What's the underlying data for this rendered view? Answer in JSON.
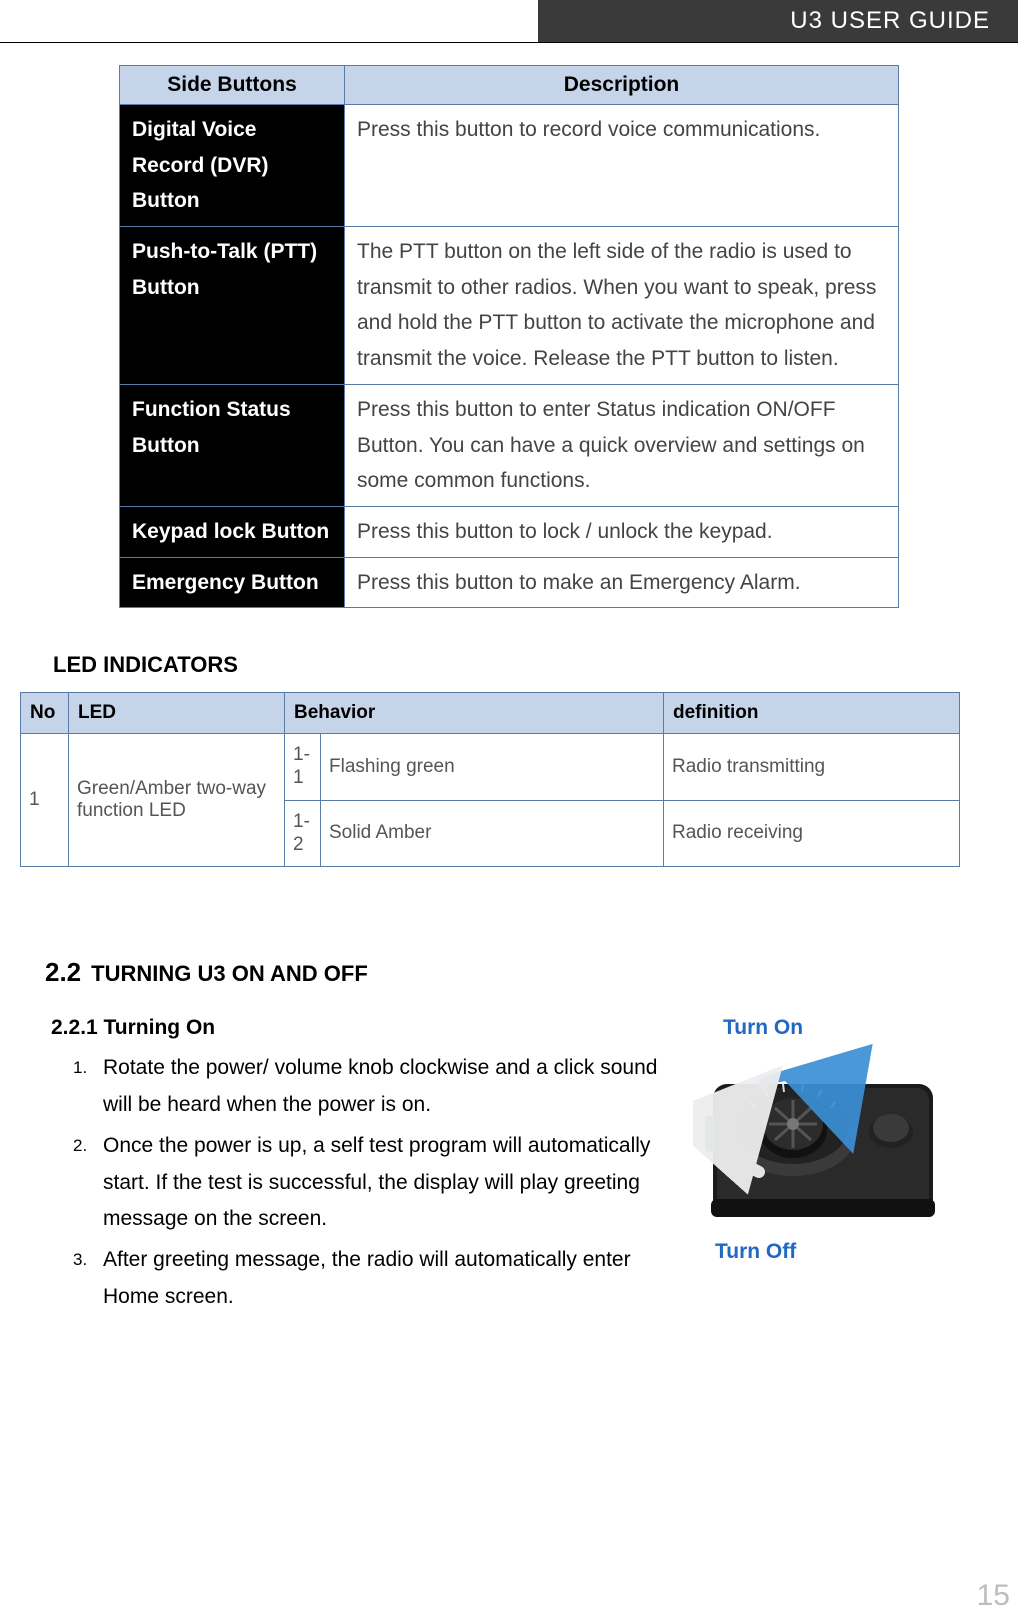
{
  "header": {
    "title": "U3 USER GUIDE"
  },
  "table1": {
    "headers": {
      "col1": "Side Buttons",
      "col2": "Description"
    },
    "rows": [
      {
        "name": "Digital Voice Record (DVR) Button",
        "desc": "Press this button to record voice communications."
      },
      {
        "name": "Push-to-Talk (PTT) Button",
        "desc": "The PTT button on the left side of the radio is used to transmit to other radios. When you want to speak, press and hold the PTT button to activate the microphone and transmit the voice. Release the PTT button to listen."
      },
      {
        "name": "Function Status Button",
        "desc": "Press this button to enter Status indication ON/OFF Button. You can have a quick overview and settings on some common functions."
      },
      {
        "name": "Keypad lock Button",
        "desc": "Press this button to lock / unlock the keypad."
      },
      {
        "name": "Emergency Button",
        "desc": "Press this button to make an Emergency Alarm."
      }
    ]
  },
  "led": {
    "heading": "LED INDICATORS",
    "headers": {
      "no": "No",
      "led": "LED",
      "behavior": "Behavior",
      "definition": "definition"
    },
    "row": {
      "no": "1",
      "led": "Green/Amber two-way function LED",
      "behaviors": [
        {
          "n": "1-1",
          "b": "Flashing green",
          "d": "Radio transmitting"
        },
        {
          "n": "1-2",
          "b": "Solid Amber",
          "d": "Radio receiving"
        }
      ]
    }
  },
  "section22": {
    "num": "2.2",
    "title": "TURNING U3 ON AND OFF",
    "sub": "2.2.1 Turning On",
    "steps": [
      "Rotate the power/ volume knob clockwise and a click sound will be heard when the power is on.",
      "Once the power is up, a self test program will automatically start. If the test is successful, the display will play greeting message on the screen.",
      "After greeting message, the radio will automatically enter Home screen."
    ],
    "fig": {
      "top": "Turn On",
      "bottom": "Turn Off"
    }
  },
  "pageNumber": "15"
}
